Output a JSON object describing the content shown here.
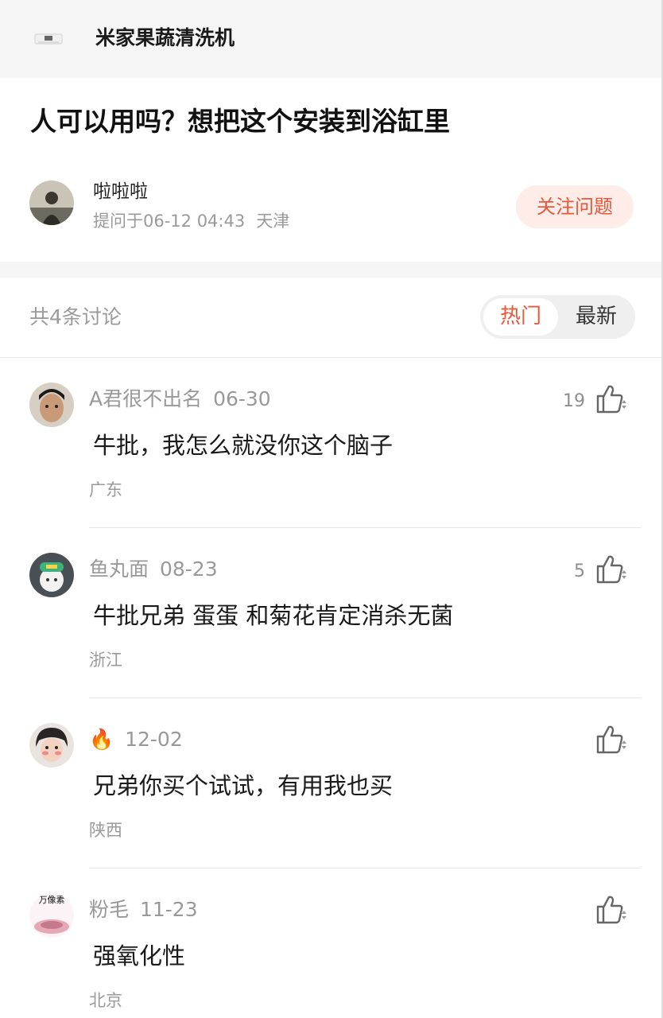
{
  "header": {
    "product_thumb_icon": "washer-thumbnail",
    "product_name": "米家果蔬清洗机"
  },
  "question": {
    "title": "人可以用吗？想把这个安装到浴缸里",
    "asker": {
      "name": "啦啦啦",
      "meta_prefix": "提问于06-12 04:43",
      "location": "天津"
    },
    "follow_label": "关注问题"
  },
  "discussion": {
    "count_label": "共4条讨论",
    "sort_hot": "热门",
    "sort_new": "最新"
  },
  "comments": [
    {
      "user": "A君很不出名",
      "date": "06-30",
      "text": "牛批，我怎么就没你这个脑子",
      "location": "广东",
      "likes": "19"
    },
    {
      "user": "鱼丸面",
      "date": "08-23",
      "text": "牛批兄弟 蛋蛋 和菊花肯定消杀无菌",
      "location": "浙江",
      "likes": "5"
    },
    {
      "user": "🔥",
      "date": "12-02",
      "text": "兄弟你买个试试，有用我也买",
      "location": "陕西",
      "likes": ""
    },
    {
      "user": "粉毛",
      "date": "11-23",
      "text": "强氧化性",
      "location": "北京",
      "likes": "",
      "avatar_text": "万像素"
    }
  ],
  "colors": {
    "accent": "#e8573a",
    "follow_bg": "#fdece8",
    "muted_text": "#9a9a9a",
    "band_bg": "#f5f5f5"
  }
}
